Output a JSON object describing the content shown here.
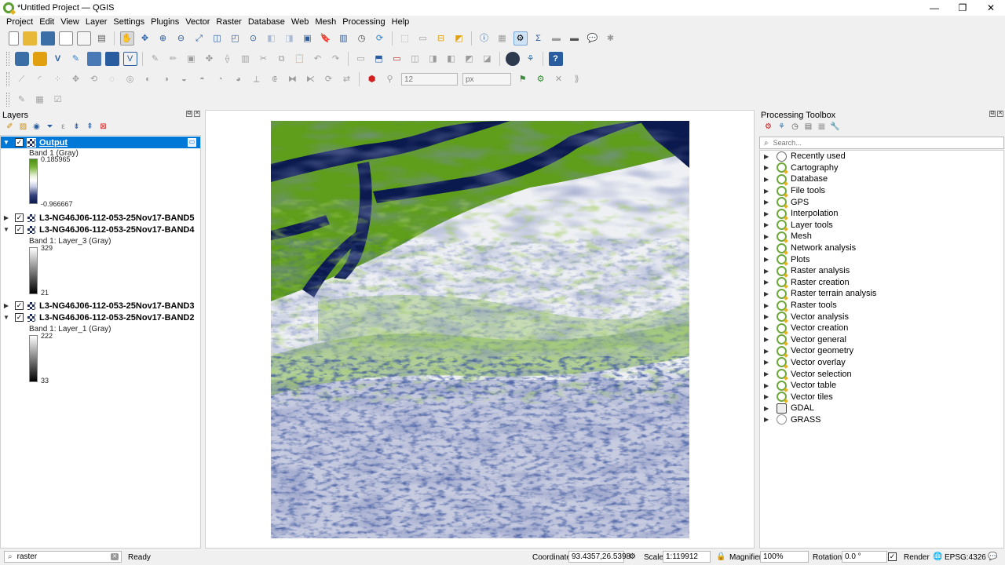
{
  "window": {
    "title": "*Untitled Project — QGIS",
    "minimize": "—",
    "maximize": "❐",
    "close": "✕"
  },
  "menubar": [
    "Project",
    "Edit",
    "View",
    "Layer",
    "Settings",
    "Plugins",
    "Vector",
    "Raster",
    "Database",
    "Web",
    "Mesh",
    "Processing",
    "Help"
  ],
  "toolbar": {
    "font_size": "12",
    "font_unit": "px"
  },
  "layers_panel": {
    "title": "Layers",
    "layers": [
      {
        "name": "Output",
        "checked": true,
        "expanded": true,
        "selected": true,
        "band": "Band 1 (Gray)",
        "max": "0.185965",
        "min": "-0.966667"
      },
      {
        "name": "L3-NG46J06-112-053-25Nov17-BAND5",
        "checked": true,
        "expanded": false
      },
      {
        "name": "L3-NG46J06-112-053-25Nov17-BAND4",
        "checked": true,
        "expanded": true,
        "band": "Band 1: Layer_3 (Gray)",
        "max": "329",
        "min": "21"
      },
      {
        "name": "L3-NG46J06-112-053-25Nov17-BAND3",
        "checked": true,
        "expanded": false
      },
      {
        "name": "L3-NG46J06-112-053-25Nov17-BAND2",
        "checked": true,
        "expanded": true,
        "band": "Band 1: Layer_1 (Gray)",
        "max": "222",
        "min": "33"
      }
    ]
  },
  "processing": {
    "title": "Processing Toolbox",
    "search_placeholder": "Search...",
    "items": [
      "Recently used",
      "Cartography",
      "Database",
      "File tools",
      "GPS",
      "Interpolation",
      "Layer tools",
      "Mesh",
      "Network analysis",
      "Plots",
      "Raster analysis",
      "Raster creation",
      "Raster terrain analysis",
      "Raster tools",
      "Vector analysis",
      "Vector creation",
      "Vector general",
      "Vector geometry",
      "Vector overlay",
      "Vector selection",
      "Vector table",
      "Vector tiles",
      "GDAL",
      "GRASS"
    ]
  },
  "statusbar": {
    "locator_value": "raster",
    "message": "Ready",
    "coordinate_label": "Coordinate",
    "coordinate": "93.4357,26.5398",
    "scale_label": "Scale",
    "scale": "1:119912",
    "magnifier_label": "Magnifier",
    "magnifier": "100%",
    "rotation_label": "Rotation",
    "rotation": "0.0 °",
    "render_label": "Render",
    "crs": "EPSG:4326"
  },
  "colors": {
    "selection": "#0078d7",
    "ramp_green": "#4a8f12",
    "ramp_navy": "#0b1a4e",
    "qgis_green": "#5a9e2f"
  }
}
